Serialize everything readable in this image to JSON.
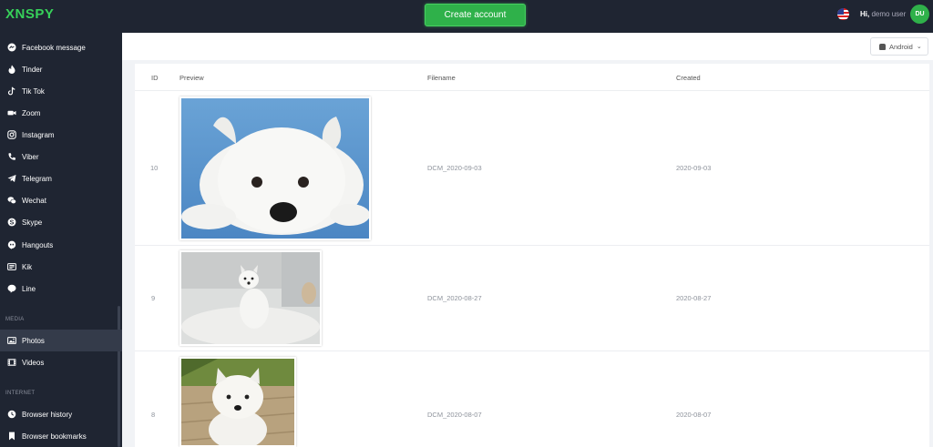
{
  "topbar": {
    "logo": "XNSPY",
    "create_account": "Create account",
    "greeting_hi": "Hi,",
    "greeting_user": "demo user",
    "avatar_initials": "DU"
  },
  "sidebar": {
    "items": [
      {
        "label": "Facebook message",
        "icon": "facebook-messenger-icon"
      },
      {
        "label": "Tinder",
        "icon": "flame-icon"
      },
      {
        "label": "Tik Tok",
        "icon": "tiktok-icon"
      },
      {
        "label": "Zoom",
        "icon": "video-camera-icon"
      },
      {
        "label": "Instagram",
        "icon": "instagram-icon"
      },
      {
        "label": "Viber",
        "icon": "phone-icon"
      },
      {
        "label": "Telegram",
        "icon": "paper-plane-icon"
      },
      {
        "label": "Wechat",
        "icon": "wechat-icon"
      },
      {
        "label": "Skype",
        "icon": "skype-icon"
      },
      {
        "label": "Hangouts",
        "icon": "hangouts-icon"
      },
      {
        "label": "Kik",
        "icon": "kik-icon"
      },
      {
        "label": "Line",
        "icon": "line-icon"
      }
    ],
    "media_header": "MEDIA",
    "media_items": [
      {
        "label": "Photos",
        "icon": "photos-icon",
        "active": true
      },
      {
        "label": "Videos",
        "icon": "film-icon"
      }
    ],
    "internet_header": "INTERNET",
    "internet_items": [
      {
        "label": "Browser history",
        "icon": "browser-history-icon"
      },
      {
        "label": "Browser bookmarks",
        "icon": "bookmark-icon"
      }
    ]
  },
  "toolbar": {
    "platform_select": "Android"
  },
  "table": {
    "headers": [
      "ID",
      "Preview",
      "Filename",
      "Created"
    ],
    "rows": [
      {
        "id": "10",
        "filename": "DCM_2020-09-03",
        "created": "2020-09-03",
        "preview": "white terrier lying on blue background"
      },
      {
        "id": "9",
        "filename": "DCM_2020-08-27",
        "created": "2020-08-27",
        "preview": "white terrier sitting on white rug"
      },
      {
        "id": "8",
        "filename": "DCM_2020-08-07",
        "created": "2020-08-07",
        "preview": "white terrier sitting on wooden deck"
      }
    ]
  },
  "colors": {
    "sidebar_bg": "#1f2532",
    "accent_green": "#2fb14a",
    "logo_green": "#37d15a"
  }
}
